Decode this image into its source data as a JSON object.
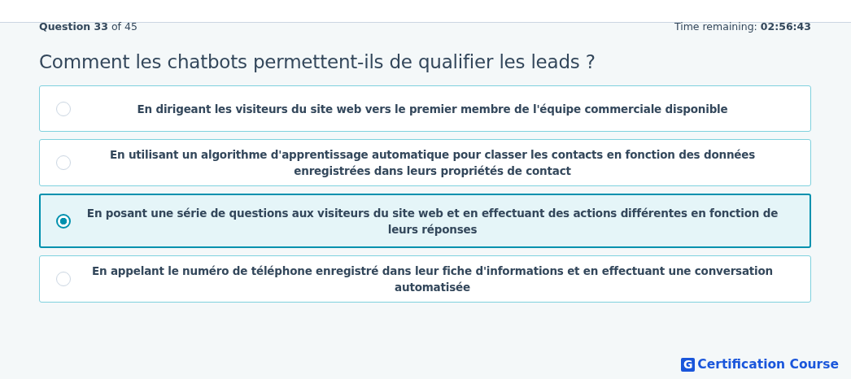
{
  "progress": {
    "counter": "**Question 33** of 45",
    "timer": "Time remaining: **02:56:43**"
  },
  "question": "Comment les chatbots permettent-ils de qualifier les leads ?",
  "options": [
    {
      "label": "En dirigeant les visiteurs du site web vers le premier membre de l'équipe commerciale disponible",
      "selected": false
    },
    {
      "label": "En utilisant un algorithme d'apprentissage automatique pour classer les contacts en fonction des données enregistrées dans leurs propriétés de contact",
      "selected": false
    },
    {
      "label": "En posant une série de questions aux visiteurs du site web et en effectuant des actions différentes en fonction de leurs réponses",
      "selected": true
    },
    {
      "label": "En appelant le numéro de téléphone enregistré dans leur fiche d'informations et en effectuant une conversation automatisée",
      "selected": false
    }
  ],
  "brand": {
    "logo_letter": "G",
    "name": "Certification Course"
  }
}
